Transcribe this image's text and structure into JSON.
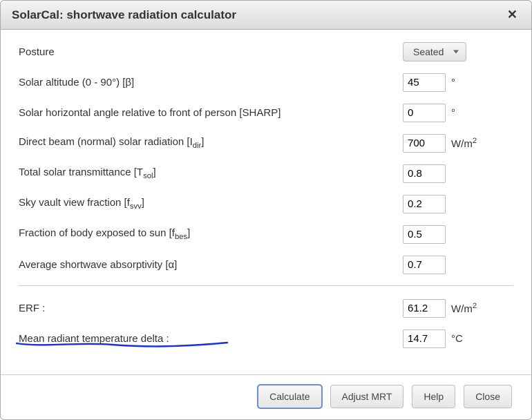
{
  "window": {
    "title": "SolarCal: shortwave radiation calculator"
  },
  "posture": {
    "label": "Posture",
    "selected": "Seated"
  },
  "inputs": {
    "altitude": {
      "label_pre": "Solar altitude (0 - 90°) [",
      "sym": "β",
      "label_post": "]",
      "value": "45",
      "unit": "°"
    },
    "sharp": {
      "label": "Solar horizontal angle relative to front of person [SHARP]",
      "value": "0",
      "unit": "°"
    },
    "idir": {
      "label_pre": "Direct beam (normal) solar radiation [I",
      "sub": "dir",
      "label_post": "]",
      "value": "700",
      "unit_html": "W/m²"
    },
    "tsol": {
      "label_pre": "Total solar transmittance [T",
      "sub": "sol",
      "label_post": "]",
      "value": "0.8"
    },
    "fsvv": {
      "label_pre": "Sky vault view fraction [f",
      "sub": "svv",
      "label_post": "]",
      "value": "0.2"
    },
    "fbes": {
      "label_pre": "Fraction of body exposed to sun [f",
      "sub": "bes",
      "label_post": "]",
      "value": "0.5"
    },
    "alpha": {
      "label_pre": "Average shortwave absorptivity [",
      "sym": "α",
      "label_post": "]",
      "value": "0.7"
    }
  },
  "outputs": {
    "erf": {
      "label": "ERF :",
      "value": "61.2",
      "unit_html": "W/m²"
    },
    "dmrt": {
      "label": "Mean radiant temperature delta :",
      "value": "14.7",
      "unit": "°C"
    }
  },
  "buttons": {
    "calculate": "Calculate",
    "adjust": "Adjust MRT",
    "help": "Help",
    "close": "Close"
  }
}
